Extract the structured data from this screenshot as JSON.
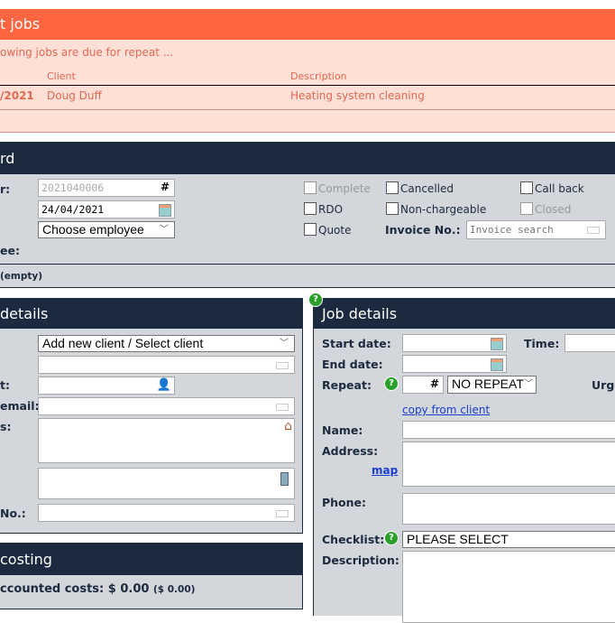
{
  "repeat_jobs": {
    "title": "t jobs",
    "intro": "owing jobs are due for repeat ...",
    "columns": [
      "Client",
      "Description"
    ],
    "rows": [
      {
        "date": "/2021",
        "client": "Doug Duff",
        "description": "Heating system cleaning"
      }
    ]
  },
  "job_card": {
    "title": "rd",
    "number_label": "r:",
    "number_value": "2021040006",
    "number_suffix": "#",
    "date_value": "24/04/2021",
    "employee_select": "Choose employee",
    "employee_label": "ee:",
    "checkboxes": {
      "complete": "Complete",
      "rdo": "RDO",
      "quote": "Quote",
      "cancelled": "Cancelled",
      "non_chargeable": "Non-chargeable",
      "call_back": "Call back",
      "closed": "Closed"
    },
    "invoice_label": "Invoice No.:",
    "invoice_placeholder": "Invoice search",
    "footer": "(empty)"
  },
  "client_details": {
    "title": "details",
    "client_select": "Add new client / Select client",
    "contact_label": "t:",
    "email_label": "email:",
    "address_label": "s:",
    "no_label": "No.:"
  },
  "costing": {
    "title": "costing",
    "label": "ccounted costs:",
    "value": "$ 0.00",
    "sub": "($ 0.00)"
  },
  "job_details": {
    "title": "Job details",
    "help": "?",
    "start_label": "Start date:",
    "time_label": "Time:",
    "end_label": "End date:",
    "repeat_label": "Repeat:",
    "repeat_suffix": "#",
    "repeat_select": "NO REPEAT",
    "urgency_label": "Urg",
    "copy_link": "copy from client",
    "name_label": "Name:",
    "address_label": "Address:",
    "map_link": "map",
    "phone_label": "Phone:",
    "checklist_label": "Checklist:",
    "checklist_select": "PLEASE SELECT",
    "description_label": "Description:"
  },
  "colors": {
    "orange": "#ff6540",
    "pink": "#ffdfd6",
    "navy": "#1b2a3e",
    "panel": "#d3d6db",
    "help": "#2aa02a"
  }
}
